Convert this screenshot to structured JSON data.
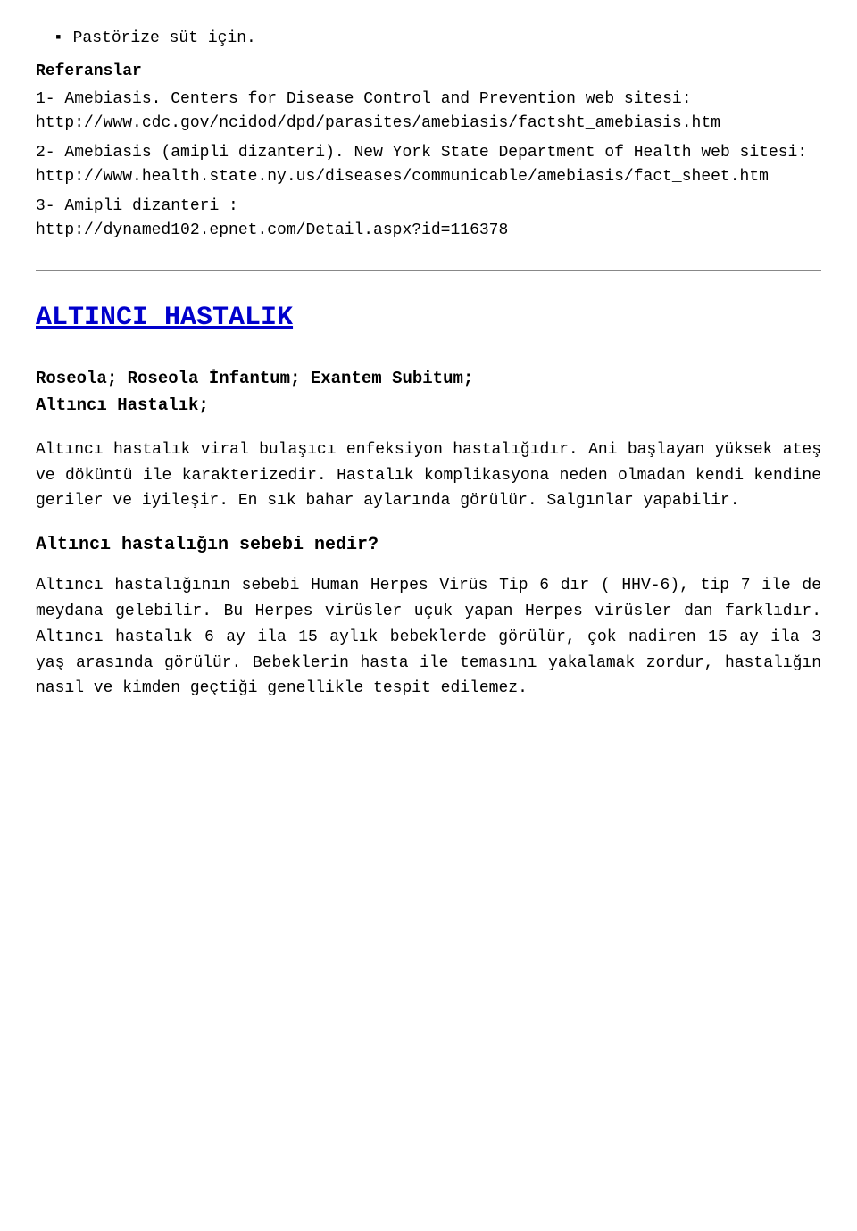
{
  "top": {
    "bullet": "Pastörize süt için."
  },
  "references": {
    "title": "Referanslar",
    "items": [
      {
        "number": "1-",
        "label": "Amebiasis. Centers for Disease Control and Prevention web sitesi:",
        "url": "http://www.cdc.gov/ncidod/dpd/parasites/amebiasis/factsht_amebiasis.htm"
      },
      {
        "number": "2-",
        "label": "Amebiasis (amipli dizanteri). New York State Department of Health    web    sitesi:",
        "url": "http://www.health.state.ny.us/diseases/communicable/amebiasis/fact_sheet.htm"
      },
      {
        "number": "3-",
        "label": "Amipli  dizanteri  :",
        "url": "http://dynamed102.epnet.com/Detail.aspx?id=116378"
      }
    ]
  },
  "section": {
    "title": "ALTINCI HASTALIK",
    "subtitle_line1": "Roseola;  Roseola  İnfantum;  Exantem  Subitum;",
    "subtitle_line2": "Altıncı Hastalık;",
    "intro": "Altıncı hastalık viral bulaşıcı enfeksiyon hastalığıdır. Ani başlayan yüksek ateş ve döküntü ile karakterizedir. Hastalık komplikasyona neden olmadan kendi kendine geriler ve iyileşir. En sık bahar aylarında görülür. Salgınlar yapabilir.",
    "subsection_title": "Altıncı hastalığın sebebi nedir?",
    "subsection_body": "Altıncı hastalığının sebebi Human Herpes Virüs Tip 6 dır ( HHV-6), tip 7 ile de meydana gelebilir. Bu Herpes virüsler uçuk yapan Herpes virüsler dan farklıdır. Altıncı hastalık 6 ay ila 15 aylık bebeklerde görülür, çok nadiren 15 ay ila 3 yaş arasında görülür. Bebeklerin hasta ile temasını yakalamak zordur, hastalığın nasıl ve kimden geçtiği genellikle tespit edilemez."
  }
}
